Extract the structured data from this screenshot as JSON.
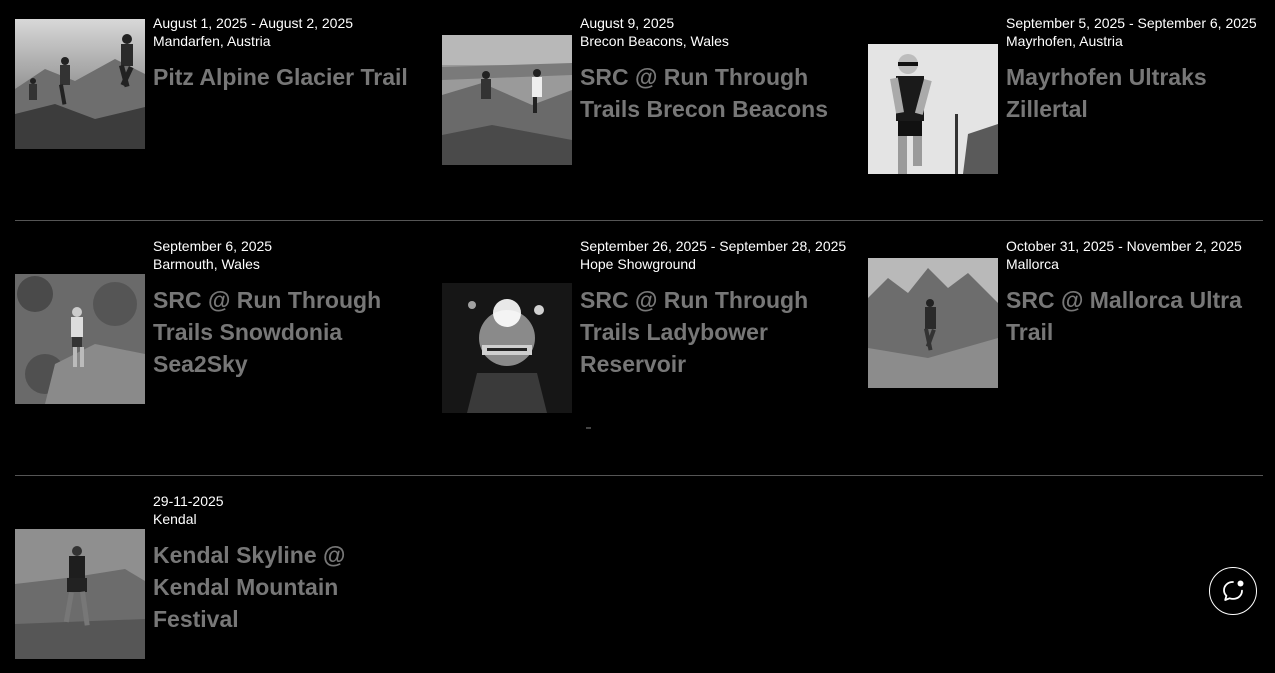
{
  "events": [
    {
      "date": "August 1, 2025 - August 2, 2025",
      "location": "Mandarfen, Austria",
      "title": "Pitz Alpine Glacier Trail",
      "image_alt": "runners on mountain trail"
    },
    {
      "date": "August 9, 2025",
      "location": "Brecon Beacons, Wales",
      "title": "SRC @ Run Through Trails Brecon Beacons",
      "image_alt": "runners on rocky coastal hill"
    },
    {
      "date": "September 5, 2025 - September 6, 2025",
      "location": "Mayrhofen, Austria",
      "title": "Mayrhofen Ultraks Zillertal",
      "image_alt": "runner with poles"
    },
    {
      "date": "September 6, 2025",
      "location": "Barmouth, Wales",
      "title": "SRC @ Run Through Trails Snowdonia Sea2Sky",
      "image_alt": "runner on rocky slope"
    },
    {
      "date": "September 26, 2025 - September 28, 2025",
      "location": "Hope Showground",
      "title": "SRC @ Run Through Trails Ladybower Reservoir",
      "image_alt": "runner with headlamp at night"
    },
    {
      "date": "October 31, 2025 - November 2, 2025",
      "location": "Mallorca",
      "title": "SRC @ Mallorca Ultra Trail",
      "image_alt": "runner on mountain ridge"
    },
    {
      "date": "29-11-2025",
      "location": "Kendal",
      "title": "Kendal Skyline @ Kendal Mountain Festival",
      "image_alt": "runner on foggy fell"
    }
  ],
  "chat": {
    "icon": "chat-bubble-icon"
  }
}
